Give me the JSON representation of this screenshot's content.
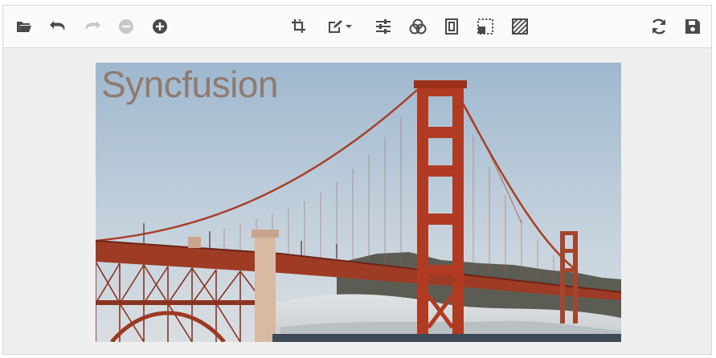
{
  "toolbar": {
    "left": [
      "open-icon",
      "undo-icon",
      "redo-icon",
      "zoom-out-icon",
      "zoom-in-icon"
    ],
    "center": [
      "crop-icon",
      "annotate-icon",
      "adjust-icon",
      "filter-icon",
      "frame-icon",
      "resize-icon",
      "redact-icon"
    ],
    "right": [
      "reset-icon",
      "save-icon"
    ]
  },
  "canvas": {
    "annotation_text": "Syncfusion"
  },
  "colors": {
    "icon": "#4a4a4a",
    "icon_disabled": "#c8c8c8",
    "accent_bridge": "#b13a22"
  }
}
